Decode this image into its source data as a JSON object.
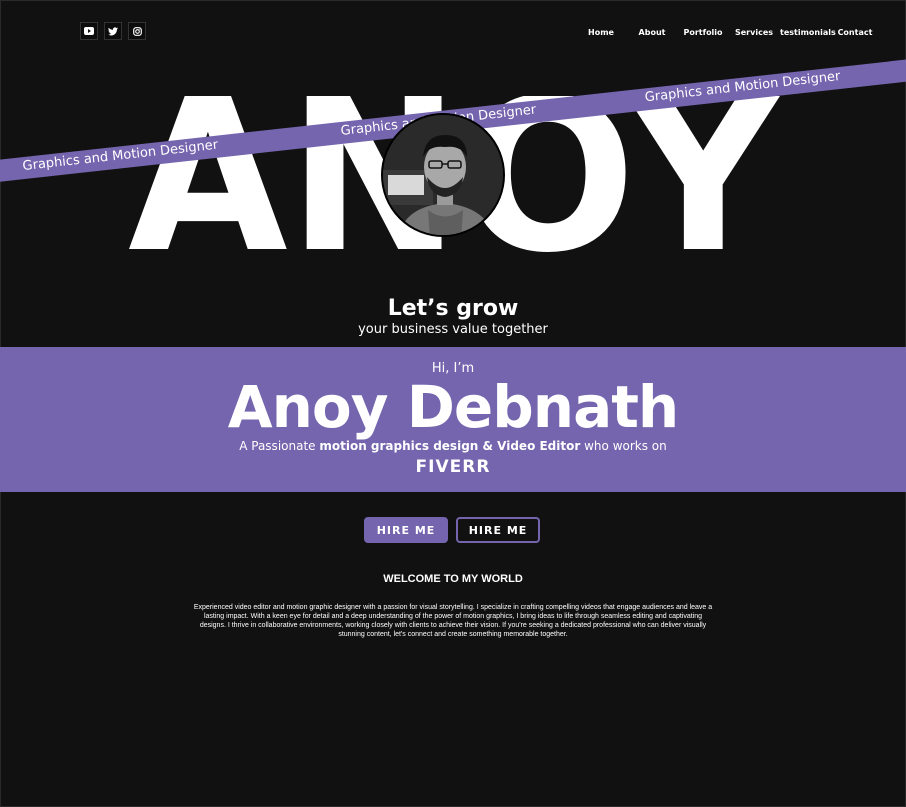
{
  "socials": [
    {
      "name": "youtube",
      "icon": "youtube-icon"
    },
    {
      "name": "twitter",
      "icon": "twitter-icon"
    },
    {
      "name": "instagram",
      "icon": "instagram-icon"
    }
  ],
  "nav": [
    "Home",
    "About",
    "Portfolio",
    "Services",
    "testimonials",
    "Contact"
  ],
  "hero": {
    "word": "ANOY",
    "banner_text": "Graphics and Motion Designer"
  },
  "grow": {
    "title": "Let’s grow",
    "subtitle": "your business value together"
  },
  "intro": {
    "greeting": "Hi, I’m",
    "name": "Anoy Debnath",
    "tagline_prefix": "A Passionate ",
    "tagline_bold": "motion graphics design & Video Editor",
    "tagline_suffix": " who works on",
    "platform": "FIVERR"
  },
  "buttons": {
    "primary": "HIRE ME",
    "secondary": "HIRE ME"
  },
  "welcome": {
    "heading": "WELCOME TO MY WORLD",
    "body": "Experienced video editor and motion graphic designer with a passion for visual storytelling. I specialize in crafting compelling videos that engage audiences and leave a lasting impact. With a keen eye for detail and a deep understanding of the power of motion graphics, I bring ideas to life through seamless editing and captivating designs. I thrive in collaborative environments, working closely with clients to achieve their vision. If you're seeking a dedicated professional who can deliver visually stunning content, let's connect and create something memorable together."
  },
  "colors": {
    "accent": "#7465ae",
    "background": "#111111",
    "text": "#ffffff"
  }
}
